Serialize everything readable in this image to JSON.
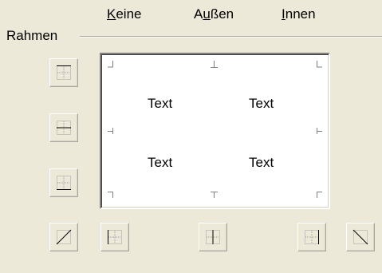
{
  "presets": {
    "none": {
      "accel": "K",
      "rest": "eine"
    },
    "outer": {
      "pre": "A",
      "accel": "u",
      "rest": "ßen"
    },
    "inner": {
      "accel": "I",
      "rest": "nnen"
    }
  },
  "group": {
    "label": "Rahmen"
  },
  "preview": {
    "texts": [
      "Text",
      "Text",
      "Text",
      "Text"
    ]
  },
  "buttons": {
    "left": [
      "border-top-icon",
      "border-horizontal-middle-icon",
      "border-bottom-icon",
      "border-diagonal-up-icon"
    ],
    "bottom": [
      "border-left-icon",
      "border-vertical-middle-icon",
      "border-right-icon",
      "border-diagonal-down-icon"
    ]
  },
  "colors": {
    "dialog_bg": "#ECE9D8",
    "preview_bg": "#FFFFFF",
    "guide": "#808080",
    "icon_dotted": "#A0A0A0",
    "icon_solid": "#000000"
  }
}
